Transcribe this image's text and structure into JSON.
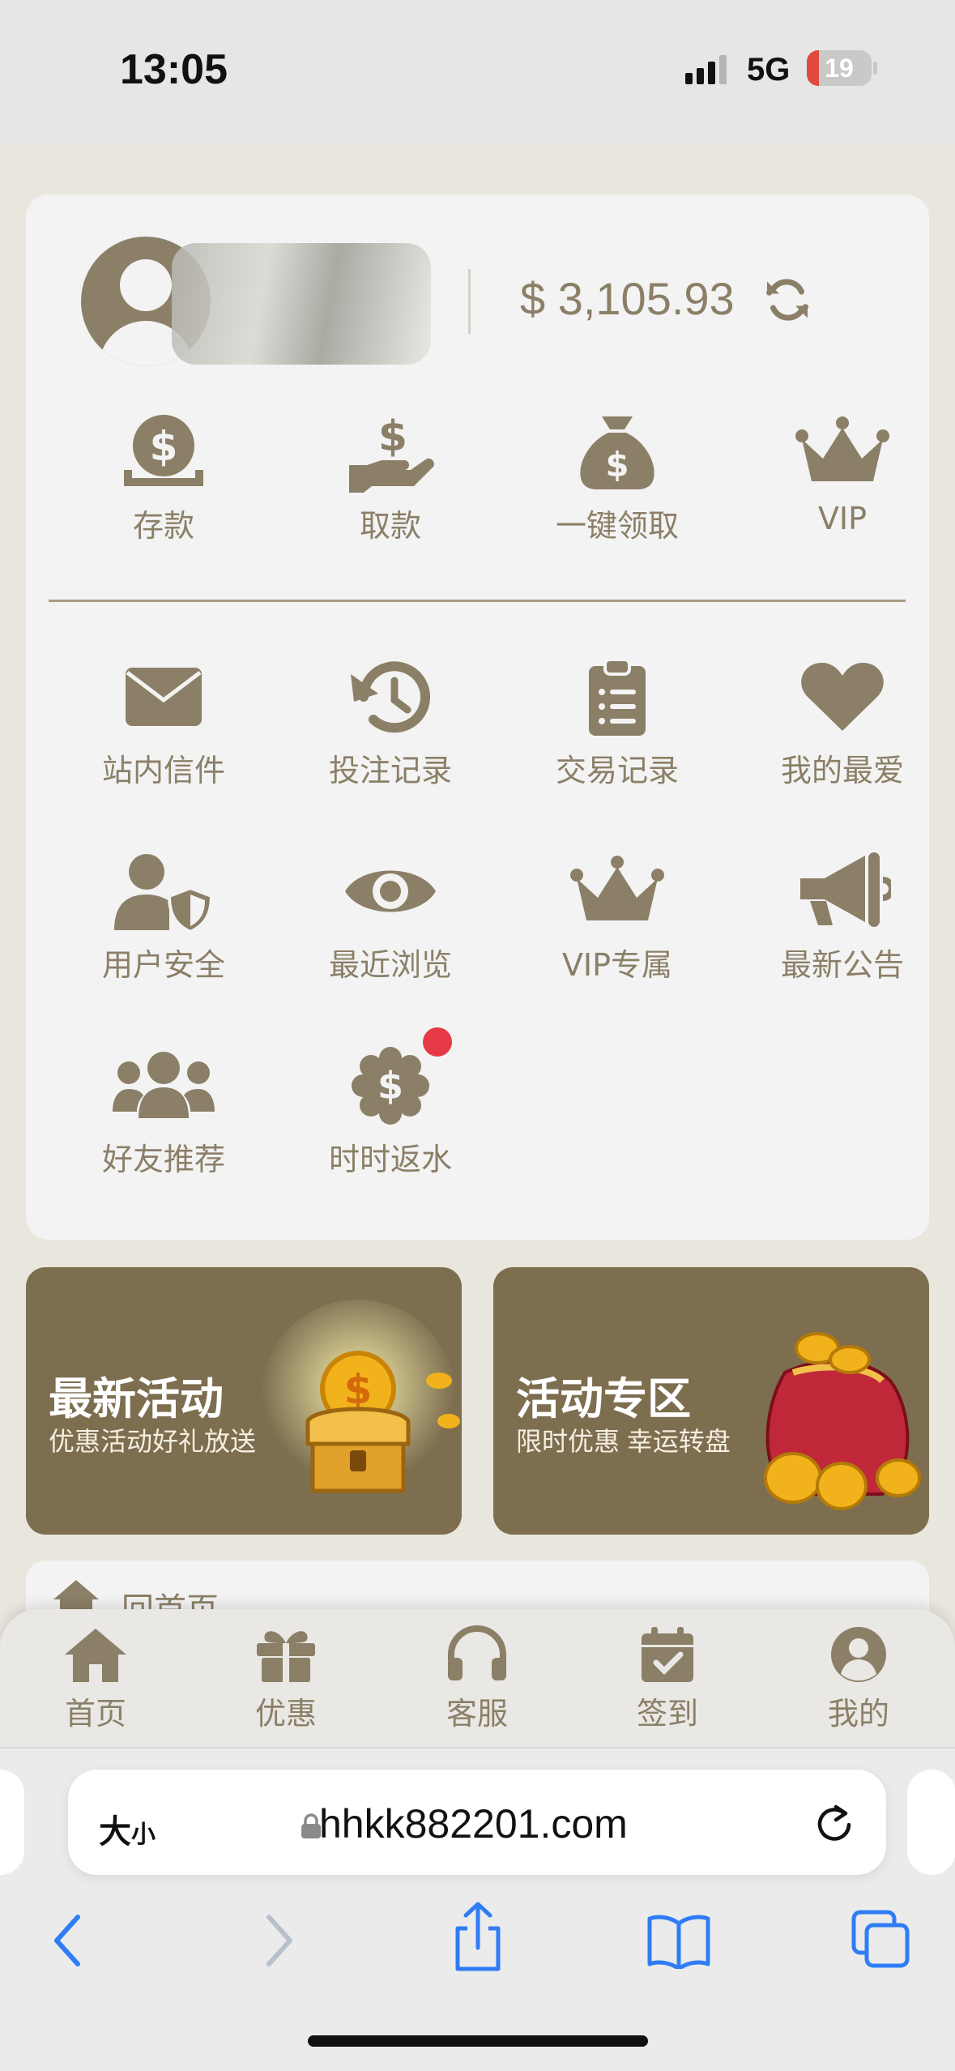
{
  "status_bar": {
    "time": "13:05",
    "network": "5G",
    "battery": "19",
    "battery_level": 0.19
  },
  "profile": {
    "balance": "$ 3,105.93"
  },
  "quick_actions": [
    {
      "label": "存款",
      "icon": "deposit-icon"
    },
    {
      "label": "取款",
      "icon": "withdraw-icon"
    },
    {
      "label": "一键领取",
      "icon": "money-bag-icon"
    },
    {
      "label": "VIP",
      "icon": "crown-icon"
    }
  ],
  "menu": [
    {
      "label": "站内信件",
      "icon": "envelope-icon"
    },
    {
      "label": "投注记录",
      "icon": "history-icon"
    },
    {
      "label": "交易记录",
      "icon": "clipboard-icon"
    },
    {
      "label": "我的最爱",
      "icon": "heart-icon"
    },
    {
      "label": "用户安全",
      "icon": "user-shield-icon"
    },
    {
      "label": "最近浏览",
      "icon": "eye-icon"
    },
    {
      "label": "VIP专属",
      "icon": "crown-icon"
    },
    {
      "label": "最新公告",
      "icon": "megaphone-icon"
    },
    {
      "label": "好友推荐",
      "icon": "users-icon"
    },
    {
      "label": "时时返水",
      "icon": "dollar-badge-icon"
    }
  ],
  "banners": [
    {
      "title": "最新活动",
      "subtitle": "优惠活动好礼放送"
    },
    {
      "title": "活动专区",
      "subtitle": "限时优惠 幸运转盘"
    }
  ],
  "home_link": "回首页",
  "tabs": [
    {
      "label": "首页",
      "icon": "home-icon"
    },
    {
      "label": "优惠",
      "icon": "gift-icon"
    },
    {
      "label": "客服",
      "icon": "headset-icon"
    },
    {
      "label": "签到",
      "icon": "calendar-check-icon"
    },
    {
      "label": "我的",
      "icon": "user-circle-icon"
    }
  ],
  "browser": {
    "text_size": "大",
    "text_size_small": "小",
    "url": "hhkk882201.com"
  },
  "colors": {
    "accent": "#8b7f67",
    "banner": "#7d6e50",
    "badge": "#e63946",
    "safari_blue": "#2f7cf6"
  }
}
